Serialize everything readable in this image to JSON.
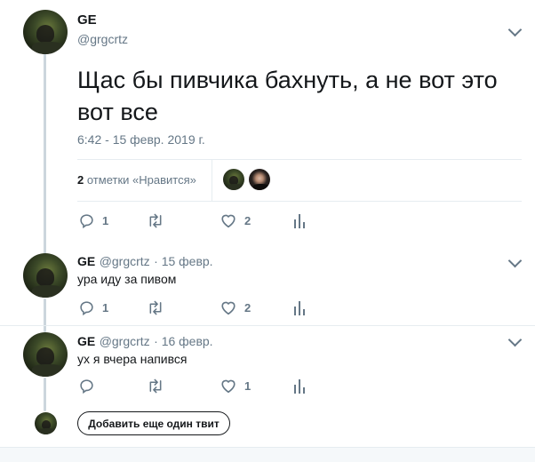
{
  "main_tweet": {
    "name": "GE",
    "handle": "@grgcrtz",
    "text": "Щас бы пивчика бахнуть, а не вот это вот все",
    "timestamp": "6:42 - 15 февр. 2019 г.",
    "likes_count": "2",
    "likes_label": "отметки «Нравится»",
    "actions": {
      "reply": "1",
      "retweet": "",
      "like": "2"
    }
  },
  "replies": [
    {
      "name": "GE",
      "handle": "@grgcrtz",
      "date": "· 15 февр.",
      "text": "ура иду за пивом",
      "actions": {
        "reply": "1",
        "retweet": "",
        "like": "2"
      }
    },
    {
      "name": "GE",
      "handle": "@grgcrtz",
      "date": "· 16 февр.",
      "text": "ух я вчера напився",
      "actions": {
        "reply": "",
        "retweet": "",
        "like": "1"
      }
    }
  ],
  "add_tweet_button": "Добавить еще один твит",
  "colors": {
    "muted": "#657786",
    "thread_line": "#ccd6dd",
    "text": "#14171a"
  }
}
